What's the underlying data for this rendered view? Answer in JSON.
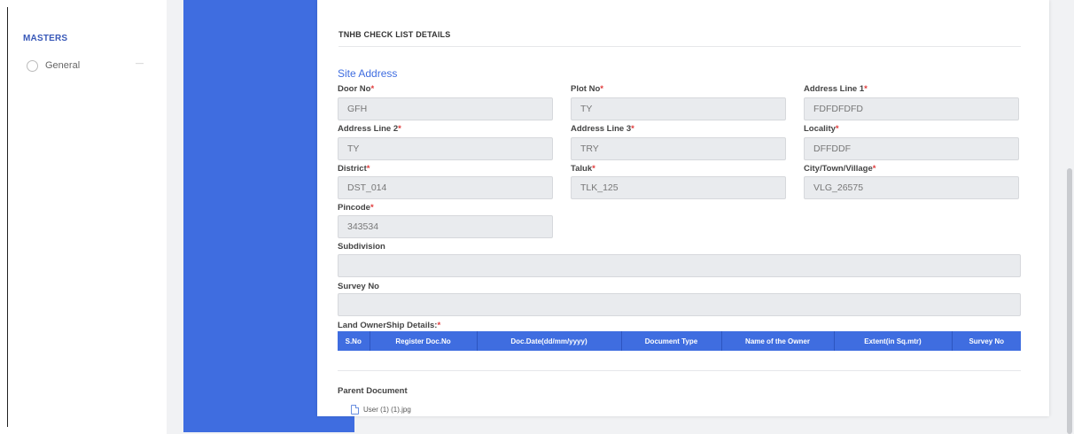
{
  "sidebar": {
    "section_title": "MASTERS",
    "items": [
      {
        "label": "General",
        "icon": "user-circle-icon"
      }
    ]
  },
  "page": {
    "title": "TNHB CHECK LIST DETAILS",
    "section": "Site Address"
  },
  "fields": {
    "door_no": {
      "label": "Door No",
      "required": "*",
      "value": "GFH"
    },
    "plot_no": {
      "label": "Plot No",
      "required": "*",
      "value": "TY"
    },
    "address_line_1": {
      "label": "Address Line 1",
      "required": "*",
      "value": "FDFDFDFD"
    },
    "address_line_2": {
      "label": "Address Line 2",
      "required": "*",
      "value": "TY"
    },
    "address_line_3": {
      "label": "Address Line 3",
      "required": "*",
      "value": "TRY"
    },
    "locality": {
      "label": "Locality",
      "required": "*",
      "value": "DFFDDF"
    },
    "district": {
      "label": "District",
      "required": "*",
      "value": "DST_014"
    },
    "taluk": {
      "label": "Taluk",
      "required": "*",
      "value": "TLK_125"
    },
    "city": {
      "label": "City/Town/Village",
      "required": "*",
      "value": "VLG_26575"
    },
    "pincode": {
      "label": "Pincode",
      "required": "*",
      "value": "343534"
    },
    "subdivision": {
      "label": "Subdivision",
      "value": ""
    },
    "survey_no": {
      "label": "Survey No",
      "value": ""
    }
  },
  "land_ownership": {
    "label": "Land OwnerShip Details:",
    "required": "*",
    "columns": [
      "S.No",
      "Register Doc.No",
      "Doc.Date(dd/mm/yyyy)",
      "Document Type",
      "Name of the Owner",
      "Extent(in Sq.mtr)",
      "Survey No"
    ]
  },
  "parent_document": {
    "label": "Parent Document",
    "file_name": "User (1) (1).jpg",
    "icon": "file-icon"
  },
  "colors": {
    "accent": "#3f6de0",
    "required": "#e03b3b"
  }
}
